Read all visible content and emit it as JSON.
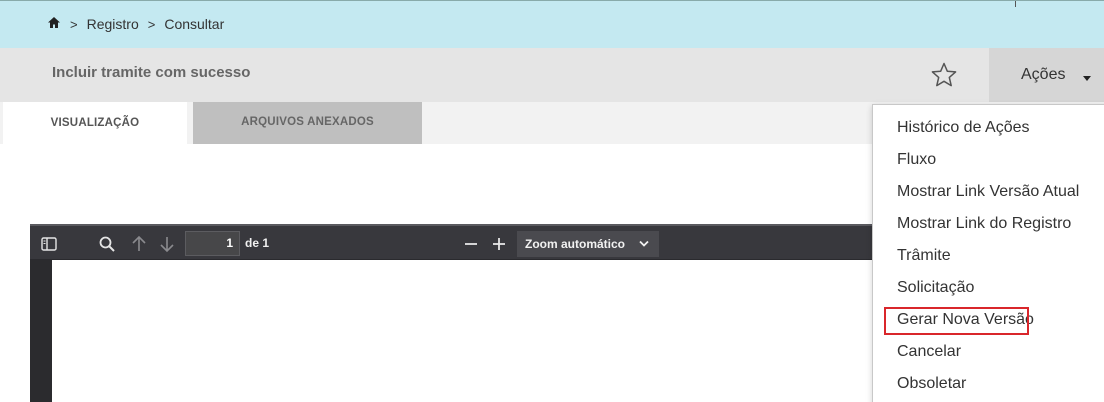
{
  "breadcrumb": {
    "items": [
      "Registro",
      "Consultar"
    ],
    "separator": ">"
  },
  "header": {
    "title": "Incluir tramite com sucesso",
    "actions_label": "Ações"
  },
  "tabs": [
    {
      "label": "VISUALIZAÇÃO",
      "active": true
    },
    {
      "label": "ARQUIVOS ANEXADOS",
      "active": false
    }
  ],
  "pdf_viewer": {
    "current_page": "1",
    "page_of": "de 1",
    "zoom": "Zoom automático"
  },
  "actions_menu": {
    "items": [
      "Histórico de Ações",
      "Fluxo",
      "Mostrar Link Versão Atual",
      "Mostrar Link do Registro",
      "Trâmite",
      "Solicitação",
      "Gerar Nova Versão",
      "Cancelar",
      "Obsoletar"
    ],
    "highlighted_item": "Gerar Nova Versão"
  },
  "colors": {
    "breadcrumb_bg": "#c4e9f1",
    "title_bar_bg": "#e5e5e5",
    "highlight_border": "#d9262b",
    "pdf_toolbar_bg": "#38383d"
  },
  "icons": [
    "home-icon",
    "star-icon",
    "caret-down-icon",
    "sidebar-toggle-icon",
    "search-icon",
    "arrow-up-icon",
    "arrow-down-icon",
    "zoom-out-icon",
    "zoom-in-icon",
    "chevron-down-icon"
  ]
}
